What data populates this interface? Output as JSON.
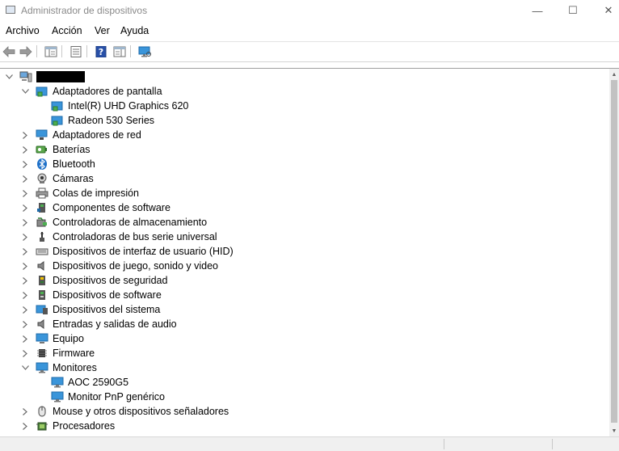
{
  "window": {
    "title": "Administrador de dispositivos",
    "controls": {
      "minimize": "—",
      "maximize": "☐",
      "close": "✕"
    }
  },
  "menu": {
    "items": [
      "Archivo",
      "Acción",
      "Ver",
      "Ayuda"
    ]
  },
  "toolbar": {
    "buttons": [
      {
        "name": "back-button",
        "icon": "arrow-left-icon"
      },
      {
        "name": "forward-button",
        "icon": "arrow-right-icon"
      },
      {
        "name": "show-hide-console-tree-button",
        "icon": "console-tree-icon"
      },
      {
        "name": "properties-button",
        "icon": "properties-icon"
      },
      {
        "name": "help-button",
        "icon": "help-icon"
      },
      {
        "name": "show-action-pane-button",
        "icon": "action-pane-icon"
      },
      {
        "name": "scan-hardware-button",
        "icon": "monitor-scan-icon"
      }
    ]
  },
  "tree": {
    "root_label": "",
    "root_redacted": true,
    "categories": [
      {
        "label": "Adaptadores de pantalla",
        "icon": "display-adapter-icon",
        "expanded": true,
        "children": [
          {
            "label": "Intel(R) UHD Graphics 620",
            "icon": "display-adapter-icon"
          },
          {
            "label": "Radeon 530 Series",
            "icon": "display-adapter-icon"
          }
        ]
      },
      {
        "label": "Adaptadores de red",
        "icon": "network-adapter-icon",
        "expanded": false
      },
      {
        "label": "Baterías",
        "icon": "battery-icon",
        "expanded": false
      },
      {
        "label": "Bluetooth",
        "icon": "bluetooth-icon",
        "expanded": false
      },
      {
        "label": "Cámaras",
        "icon": "camera-icon",
        "expanded": false
      },
      {
        "label": "Colas de impresión",
        "icon": "printer-icon",
        "expanded": false
      },
      {
        "label": "Componentes de software",
        "icon": "software-component-icon",
        "expanded": false
      },
      {
        "label": "Controladoras de almacenamiento",
        "icon": "storage-controller-icon",
        "expanded": false
      },
      {
        "label": "Controladoras de bus serie universal",
        "icon": "usb-icon",
        "expanded": false
      },
      {
        "label": "Dispositivos de interfaz de usuario (HID)",
        "icon": "hid-keyboard-icon",
        "expanded": false
      },
      {
        "label": "Dispositivos de juego, sonido y video",
        "icon": "speaker-icon",
        "expanded": false
      },
      {
        "label": "Dispositivos de seguridad",
        "icon": "security-device-icon",
        "expanded": false
      },
      {
        "label": "Dispositivos de software",
        "icon": "software-device-icon",
        "expanded": false
      },
      {
        "label": "Dispositivos del sistema",
        "icon": "system-device-icon",
        "expanded": false
      },
      {
        "label": "Entradas y salidas de audio",
        "icon": "speaker-icon",
        "expanded": false
      },
      {
        "label": "Equipo",
        "icon": "computer-icon",
        "expanded": false
      },
      {
        "label": "Firmware",
        "icon": "firmware-chip-icon",
        "expanded": false
      },
      {
        "label": "Monitores",
        "icon": "monitor-icon",
        "expanded": true,
        "children": [
          {
            "label": "AOC 2590G5",
            "icon": "monitor-icon"
          },
          {
            "label": "Monitor PnP genérico",
            "icon": "monitor-icon"
          }
        ]
      },
      {
        "label": "Mouse y otros dispositivos señaladores",
        "icon": "mouse-icon",
        "expanded": false
      },
      {
        "label": "Procesadores",
        "icon": "processor-icon",
        "expanded": false
      }
    ]
  },
  "colors": {
    "accent": "#0078d7",
    "monitor_blue": "#2e8fd6",
    "redacted": "#000000"
  }
}
